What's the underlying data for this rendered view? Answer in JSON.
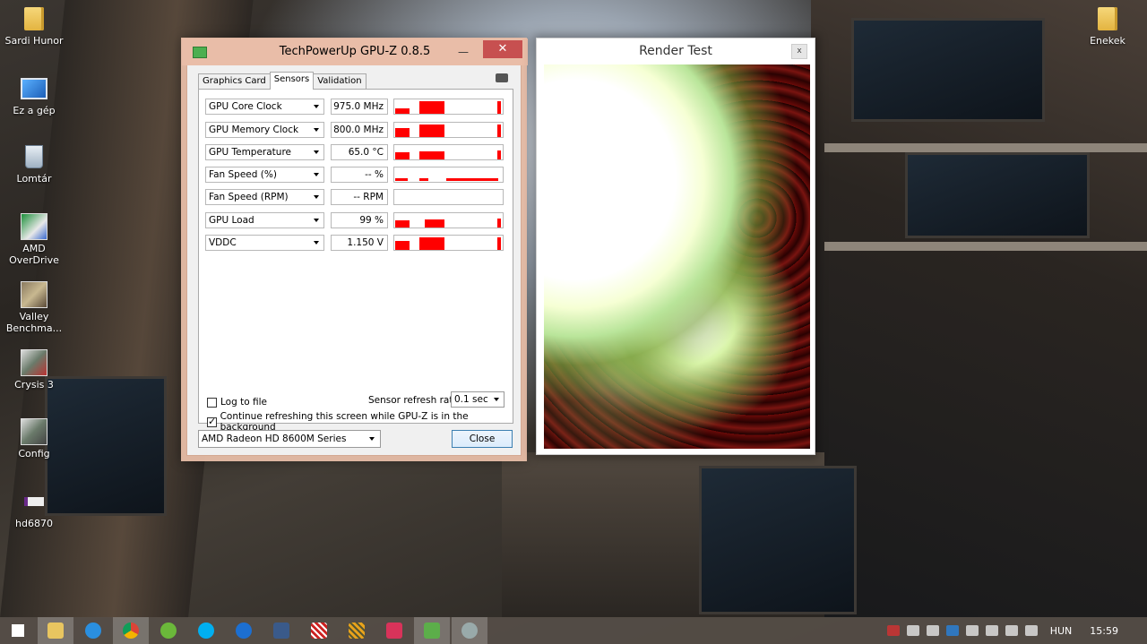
{
  "desktop": {
    "icons": [
      {
        "label": "Sardi Hunor",
        "icon": "folder-icon"
      },
      {
        "label": "Ez a gép",
        "icon": "computer-icon"
      },
      {
        "label": "Lomtár",
        "icon": "recycle-bin-icon"
      },
      {
        "label": "AMD OverDrive",
        "icon": "amd-overdrive-icon"
      },
      {
        "label": "Valley Benchma...",
        "icon": "valley-benchmark-icon"
      },
      {
        "label": "Crysis 3",
        "icon": "crysis-icon"
      },
      {
        "label": "Config",
        "icon": "config-icon"
      },
      {
        "label": "hd6870",
        "icon": "hd6870-icon"
      },
      {
        "label": "Enekek",
        "icon": "folder-icon"
      }
    ]
  },
  "gpuz": {
    "title": "TechPowerUp GPU-Z 0.8.5",
    "minimize": "—",
    "close_x": "✕",
    "tabs": [
      "Graphics Card",
      "Sensors",
      "Validation"
    ],
    "active_tab": "Sensors",
    "sensors": [
      {
        "name": "GPU Core Clock",
        "value": "975.0 MHz"
      },
      {
        "name": "GPU Memory Clock",
        "value": "800.0 MHz"
      },
      {
        "name": "GPU Temperature",
        "value": "65.0 °C"
      },
      {
        "name": "Fan Speed (%)",
        "value": "-- %"
      },
      {
        "name": "Fan Speed (RPM)",
        "value": "-- RPM"
      },
      {
        "name": "GPU Load",
        "value": "99 %"
      },
      {
        "name": "VDDC",
        "value": "1.150 V"
      }
    ],
    "log_to_file": {
      "label": "Log to file",
      "checked": false
    },
    "refresh_label": "Sensor refresh rate:",
    "refresh_value": "0.1 sec",
    "continue_refresh": {
      "label": "Continue refreshing this screen while GPU-Z is in the background",
      "checked": true
    },
    "card_select": "AMD Radeon HD 8600M Series",
    "close_button": "Close",
    "graph_color": "#ff0000"
  },
  "render_test": {
    "title": "Render Test",
    "close_x": "x"
  },
  "taskbar": {
    "apps": [
      "start-icon",
      "file-explorer-icon",
      "internet-explorer-icon",
      "chrome-icon",
      "utorrent-icon",
      "skype-icon",
      "flash-icon",
      "media-icon",
      "app-red-icon",
      "app-orange-icon",
      "app-pink-icon",
      "gpuz-icon",
      "render-icon"
    ],
    "language": "HUN",
    "time": "15:59"
  }
}
